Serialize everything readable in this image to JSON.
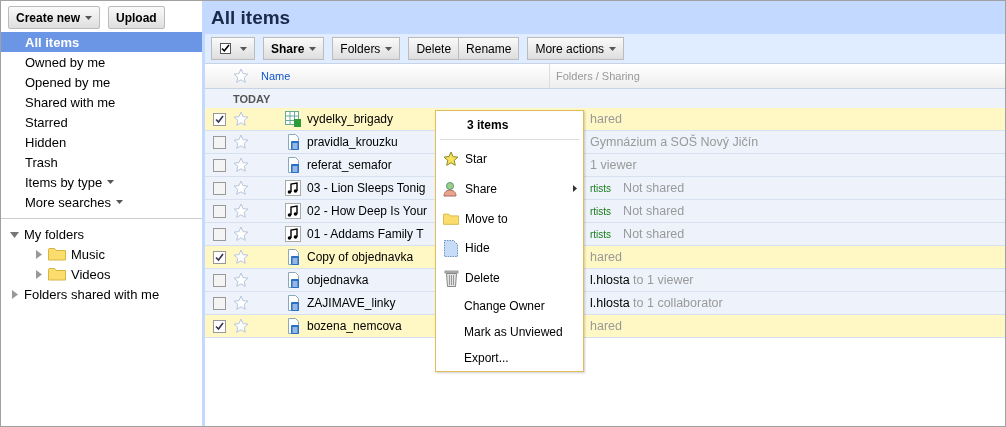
{
  "sidebar": {
    "buttons": [
      {
        "label": "Create new",
        "has_menu": true
      },
      {
        "label": "Upload",
        "has_menu": false
      }
    ],
    "nav": [
      {
        "label": "All items",
        "selected": true,
        "has_menu": false
      },
      {
        "label": "Owned by me",
        "selected": false,
        "has_menu": false
      },
      {
        "label": "Opened by me",
        "selected": false,
        "has_menu": false
      },
      {
        "label": "Shared with me",
        "selected": false,
        "has_menu": false
      },
      {
        "label": "Starred",
        "selected": false,
        "has_menu": false
      },
      {
        "label": "Hidden",
        "selected": false,
        "has_menu": false
      },
      {
        "label": "Trash",
        "selected": false,
        "has_menu": false
      },
      {
        "label": "Items by type",
        "selected": false,
        "has_menu": true
      },
      {
        "label": "More searches",
        "selected": false,
        "has_menu": true
      }
    ],
    "folders": [
      {
        "label": "My folders",
        "expanded": true,
        "children": [
          {
            "label": "Music",
            "expanded": false
          },
          {
            "label": "Videos",
            "expanded": false
          }
        ]
      },
      {
        "label": "Folders shared with me",
        "expanded": false
      }
    ]
  },
  "title": "All items",
  "toolbar": [
    [
      {
        "kind": "select",
        "checked": true
      }
    ],
    [
      {
        "kind": "button",
        "label": "Share",
        "has_menu": true
      }
    ],
    [
      {
        "kind": "button",
        "label": "Folders",
        "has_menu": true
      }
    ],
    [
      {
        "kind": "button",
        "label": "Delete",
        "has_menu": false
      },
      {
        "kind": "button",
        "label": "Rename",
        "has_menu": false
      }
    ],
    [
      {
        "kind": "button",
        "label": "More actions",
        "has_menu": true
      }
    ]
  ],
  "table": {
    "columns": [
      "Name",
      "Folders / Sharing"
    ],
    "group": "TODAY",
    "rows": [
      {
        "selected": true,
        "starred": false,
        "kind": "spreadsheet",
        "name": "vydelky_brigady",
        "sharing": {
          "text": "hared"
        }
      },
      {
        "selected": false,
        "starred": false,
        "kind": "document",
        "name": "pravidla_krouzku",
        "sharing": {
          "text": "Gymnázium a SOŠ Nový Jičín"
        }
      },
      {
        "selected": false,
        "starred": false,
        "kind": "document",
        "name": "referat_semafor",
        "sharing": {
          "text": "1 viewer"
        }
      },
      {
        "selected": false,
        "starred": false,
        "kind": "audio",
        "name": "03 - Lion Sleeps Tonig",
        "sharing": {
          "tag": "rtists",
          "text": "Not shared"
        }
      },
      {
        "selected": false,
        "starred": false,
        "kind": "audio",
        "name": "02 - How Deep Is Your",
        "sharing": {
          "tag": "rtists",
          "text": "Not shared"
        }
      },
      {
        "selected": false,
        "starred": false,
        "kind": "audio",
        "name": "01 - Addams Family T",
        "sharing": {
          "tag": "rtists",
          "text": "Not shared"
        }
      },
      {
        "selected": true,
        "starred": false,
        "kind": "document",
        "name": "Copy of objednavka",
        "sharing": {
          "text": "hared"
        }
      },
      {
        "selected": false,
        "starred": false,
        "kind": "document",
        "name": "objednavka",
        "sharing": {
          "owner": "l.hlosta",
          "text": "to 1 viewer"
        }
      },
      {
        "selected": false,
        "starred": false,
        "kind": "document",
        "name": "ZAJIMAVE_linky",
        "sharing": {
          "owner": "l.hlosta",
          "text": "to 1 collaborator"
        }
      },
      {
        "selected": true,
        "starred": false,
        "kind": "document",
        "name": "bozena_nemcova",
        "sharing": {
          "text": "hared"
        }
      }
    ]
  },
  "context_menu": {
    "title": "3 items",
    "items": [
      {
        "kind": "star",
        "label": "Star",
        "submenu": false
      },
      {
        "kind": "share",
        "label": "Share",
        "submenu": true
      },
      {
        "kind": "folder",
        "label": "Move to",
        "submenu": false
      },
      {
        "kind": "hide",
        "label": "Hide",
        "submenu": false
      },
      {
        "kind": "delete",
        "label": "Delete",
        "submenu": false
      },
      {
        "kind": "plain",
        "label": "Change Owner",
        "submenu": false
      },
      {
        "kind": "plain",
        "label": "Mark as Unviewed",
        "submenu": false
      },
      {
        "kind": "plain",
        "label": "Export...",
        "submenu": false
      }
    ]
  }
}
